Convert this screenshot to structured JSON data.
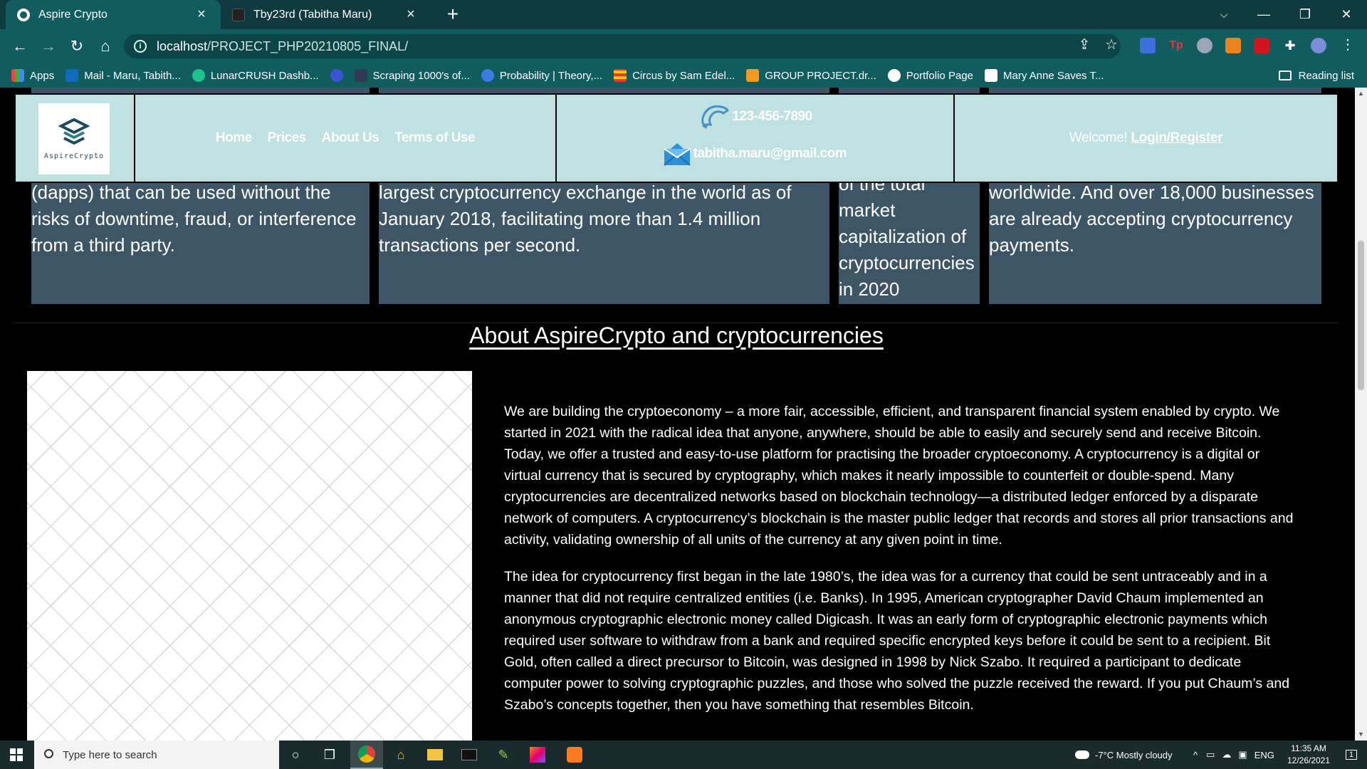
{
  "browser": {
    "tabs": [
      {
        "title": "Aspire Crypto",
        "active": true
      },
      {
        "title": "Tby23rd (Tabitha Maru)",
        "active": false
      }
    ],
    "url_host": "localhost",
    "url_path": "/PROJECT_PHP20210805_FINAL/",
    "bookmarks": [
      "Apps",
      "Mail - Maru, Tabith...",
      "LunarCRUSH Dashb...",
      "",
      "Scraping 1000's of...",
      "Probability | Theory,...",
      "Circus by Sam Edel...",
      "GROUP PROJECT.dr...",
      "Portfolio Page",
      "Mary Anne Saves T..."
    ],
    "reading_list": "Reading list"
  },
  "header": {
    "logo_text": "AspireCrypto",
    "nav": [
      "Home",
      "Prices",
      "About Us",
      "Terms of Use"
    ],
    "phone": "123-456-7890",
    "email": "tabitha.maru@gmail.com",
    "welcome": "Welcome!",
    "login": "Login/Register"
  },
  "stats": [
    {
      "lines": [
        "(dapps) that can be used without the",
        "risks of downtime, fraud, or interference",
        "from a third party."
      ]
    },
    {
      "lines": [
        "largest cryptocurrency exchange in the world as of",
        "January 2018, facilitating more than 1.4 million",
        "transactions per second."
      ]
    },
    {
      "lines": [
        "of the total",
        "market",
        "capitalization of",
        "cryptocurrencies",
        "in 2020"
      ]
    },
    {
      "lines": [
        "worldwide. And over 18,000 businesses",
        "are already accepting cryptocurrency",
        "payments."
      ]
    }
  ],
  "about": {
    "title": "About AspireCrypto and cryptocurrencies",
    "p1": "We are building the cryptoeconomy – a more fair, accessible, efficient, and transparent financial system enabled by crypto. We started in 2021 with the radical idea that anyone, anywhere, should be able to easily and securely send and receive Bitcoin. Today, we offer a trusted and easy-to-use platform for practising the broader cryptoeconomy. A cryptocurrency is a digital or virtual currency that is secured by cryptography, which makes it nearly impossible to counterfeit or double-spend. Many cryptocurrencies are decentralized networks based on blockchain technology—a distributed ledger enforced by a disparate network of computers. A cryptocurrency’s blockchain is the master public ledger that records and stores all prior transactions and activity, validating ownership of all units of the currency at any given point in time.",
    "p2": "The idea for cryptocurrency first began in the late 1980’s, the idea was for a currency that could be sent untraceably and in a manner that did not require centralized entities (i.e. Banks). In 1995, American cryptographer David Chaum implemented an anonymous cryptographic electronic money called Digicash. It was an early form of cryptographic electronic payments which required user software to withdraw from a bank and required specific encrypted keys before it could be sent to a recipient. Bit Gold, often called a direct precursor to Bitcoin, was designed in 1998 by Nick Szabo. It required a participant to dedicate computer power to solving cryptographic puzzles, and those who solved the puzzle received the reward. If you put Chaum’s and Szabo’s concepts together, then you have something that resembles Bitcoin."
  },
  "taskbar": {
    "search_placeholder": "Type here to search",
    "weather": "-7°C  Mostly cloudy",
    "lang": "ENG",
    "time": "11:35 AM",
    "date": "12/26/2021",
    "notifications": "1"
  }
}
